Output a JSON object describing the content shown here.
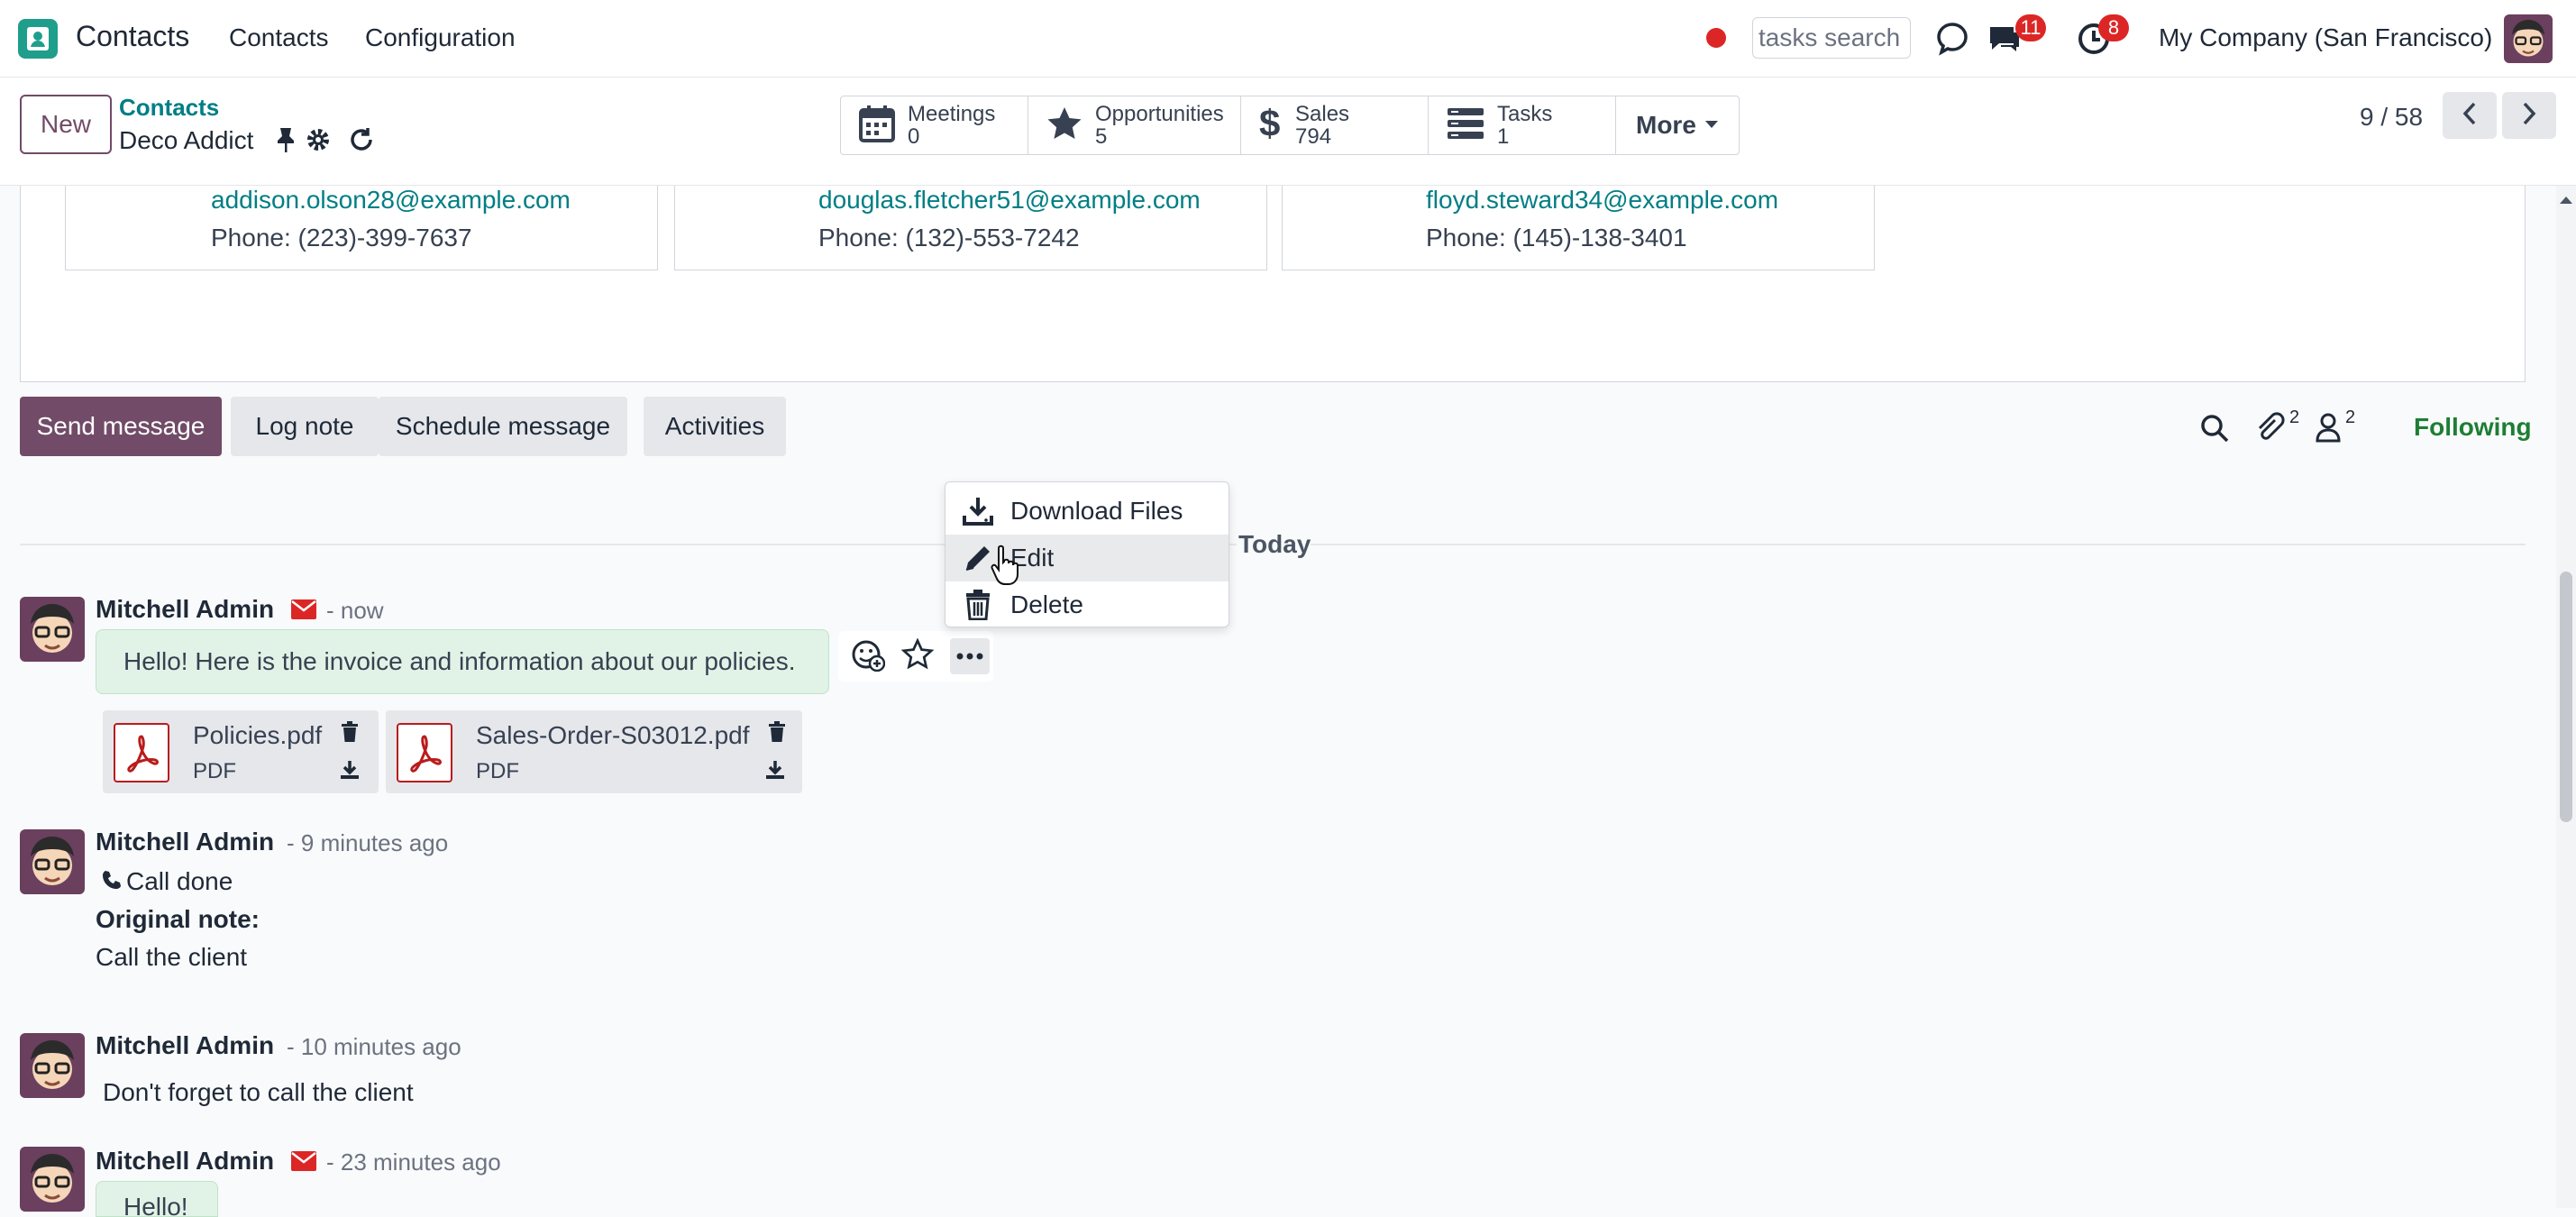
{
  "navbar": {
    "app_name": "Contacts",
    "menu": [
      "Contacts",
      "Configuration"
    ],
    "search_value": "tasks search",
    "messages_badge": "11",
    "activities_badge": "8",
    "company": "My Company (San Francisco)"
  },
  "control": {
    "new_label": "New",
    "breadcrumb_parent": "Contacts",
    "breadcrumb_current": "Deco Addict",
    "smart_buttons": [
      {
        "label": "Meetings",
        "value": "0",
        "icon": "calendar-icon"
      },
      {
        "label": "Opportunities",
        "value": "5",
        "icon": "star-icon"
      },
      {
        "label": "Sales",
        "value": "794",
        "icon": "dollar-icon"
      },
      {
        "label": "Tasks",
        "value": "1",
        "icon": "tasks-icon"
      }
    ],
    "more_label": "More",
    "pager": "9 / 58"
  },
  "contacts": [
    {
      "email": "addison.olson28@example.com",
      "phone": "Phone: (223)-399-7637"
    },
    {
      "email": "douglas.fletcher51@example.com",
      "phone": "Phone: (132)-553-7242"
    },
    {
      "email": "floyd.steward34@example.com",
      "phone": "Phone: (145)-138-3401"
    }
  ],
  "chatter": {
    "send_message": "Send message",
    "log_note": "Log note",
    "schedule_message": "Schedule message",
    "activities": "Activities",
    "attachments_count": "2",
    "followers_count": "2",
    "following": "Following"
  },
  "feed": {
    "today": "Today",
    "messages": [
      {
        "author": "Mitchell Admin",
        "time": "- now",
        "body": "Hello! Here is the invoice and information about our policies.",
        "attachments": [
          {
            "name": "Policies.pdf",
            "type": "PDF"
          },
          {
            "name": "Sales-Order-S03012.pdf",
            "type": "PDF"
          }
        ]
      },
      {
        "author": "Mitchell Admin",
        "time": "- 9 minutes ago",
        "activity": "Call done",
        "note_label": "Original note:",
        "note": "Call the client"
      },
      {
        "author": "Mitchell Admin",
        "time": "- 10 minutes ago",
        "body": "Don't forget to call the client"
      },
      {
        "author": "Mitchell Admin",
        "time": "- 23 minutes ago",
        "body": "Hello!"
      }
    ]
  },
  "dropdown": {
    "items": [
      {
        "label": "Download Files",
        "icon": "download-icon"
      },
      {
        "label": "Edit",
        "icon": "pencil-icon"
      },
      {
        "label": "Delete",
        "icon": "trash-icon"
      }
    ]
  },
  "colors": {
    "brand": "#714b67",
    "link": "#017e84",
    "badge": "#dc2626",
    "bubble": "#e1f3e6",
    "following": "#1e7e34"
  }
}
